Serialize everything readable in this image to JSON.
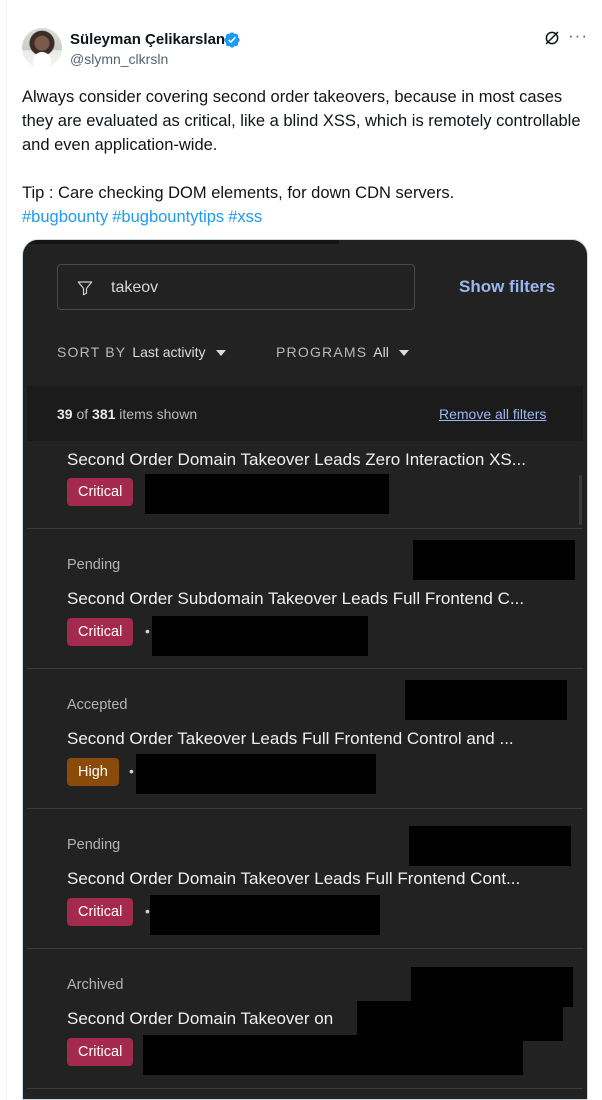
{
  "author": {
    "name": "Süleyman Çelikarslan",
    "handle": "@slymn_clkrsln",
    "more_label": "···"
  },
  "tweet": {
    "body": "Always consider covering second order takeovers, because in most cases they are evaluated as critical, like a blind XSS, which is remotely controllable and even application-wide.",
    "tip": "Tip : Care checking DOM elements, for down CDN servers.",
    "hashtags": [
      "#bugbounty",
      "#bugbountytips",
      "#xss"
    ]
  },
  "screenshot": {
    "search_value": "takeov",
    "show_filters": "Show filters",
    "sort_label": "SORT BY",
    "sort_value": "Last activity",
    "programs_label": "PROGRAMS",
    "programs_value": "All",
    "count_shown": "39",
    "count_of": "of",
    "count_total": "381",
    "count_suffix": "items shown",
    "remove_filters": "Remove all filters",
    "reports": [
      {
        "status": "",
        "title": "Second Order Domain Takeover Leads Zero Interaction XS...",
        "severity": "Critical"
      },
      {
        "status": "Pending",
        "title": "Second Order Subdomain Takeover Leads Full Frontend C...",
        "severity": "Critical"
      },
      {
        "status": "Accepted",
        "title": "Second Order Takeover Leads Full Frontend Control and ...",
        "severity": "High"
      },
      {
        "status": "Pending",
        "title": "Second Order Domain Takeover Leads Full Frontend Cont...",
        "severity": "Critical"
      },
      {
        "status": "Archived",
        "title": "Second Order Domain Takeover on",
        "severity": "Critical"
      }
    ],
    "dot": "•"
  },
  "colors": {
    "verified": "#1d9bf0",
    "hashtag": "#1d9bf0",
    "critical": "#a4294e",
    "high": "#8a4a0a",
    "link": "#9cb6f0"
  }
}
